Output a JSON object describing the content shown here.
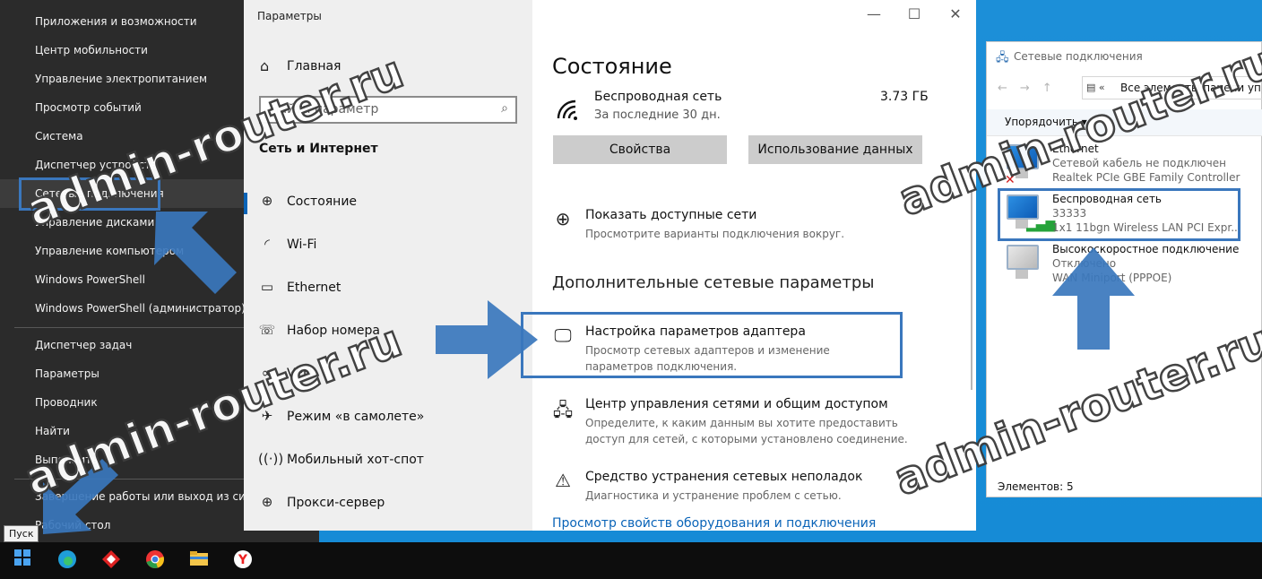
{
  "winx_menu": {
    "group1": [
      "Приложения и возможности",
      "Центр мобильности",
      "Управление электропитанием",
      "Просмотр событий",
      "Система",
      "Диспетчер устройств",
      "Сетевые подключения",
      "Управление дисками",
      "Управление компьютером",
      "Windows PowerShell",
      "Windows PowerShell (администратор)"
    ],
    "group2": [
      "Диспетчер задач",
      "Параметры",
      "Проводник",
      "Найти",
      "Выполнить"
    ],
    "group3": [
      "Завершение работы или выход из системы",
      "Рабочий стол"
    ],
    "highlighted": "Сетевые подключения"
  },
  "settings": {
    "window_title": "Параметры",
    "home": "Главная",
    "search_placeholder": "Найти параметр",
    "section": "Сеть и Интернет",
    "nav": [
      {
        "label": "Состояние",
        "icon": "globe-icon"
      },
      {
        "label": "Wi-Fi",
        "icon": "wifi-icon"
      },
      {
        "label": "Ethernet",
        "icon": "ethernet-icon"
      },
      {
        "label": "Набор номера",
        "icon": "dialup-icon"
      },
      {
        "label": "VPN",
        "icon": "vpn-icon"
      },
      {
        "label": "Режим «в самолете»",
        "icon": "airplane-icon"
      },
      {
        "label": "Мобильный хот-спот",
        "icon": "hotspot-icon"
      },
      {
        "label": "Прокси-сервер",
        "icon": "globe-icon"
      }
    ],
    "page_title": "Состояние",
    "network": {
      "name": "Беспроводная сеть",
      "period": "За последние 30 дн.",
      "usage": "3.73 ГБ"
    },
    "buttons": {
      "properties": "Свойства",
      "data_usage": "Использование данных"
    },
    "show_networks": {
      "title": "Показать доступные сети",
      "desc": "Просмотрите варианты подключения вокруг."
    },
    "advanced_heading": "Дополнительные сетевые параметры",
    "adapter": {
      "title": "Настройка параметров адаптера",
      "desc": "Просмотр сетевых адаптеров и изменение параметров подключения."
    },
    "sharing_center": {
      "title": "Центр управления сетями и общим доступом",
      "desc": "Определите, к каким данным вы хотите предоставить доступ для сетей, с которыми установлено соединение."
    },
    "troubleshoot": {
      "title": "Средство устранения сетевых неполадок",
      "desc": "Диагностика и устранение проблем с сетью."
    },
    "hardware_link": "Просмотр свойств оборудования и подключения"
  },
  "net_connections": {
    "window_title": "Сетевые подключения",
    "address": "Все элементы панели управления",
    "organize": "Упорядочить ▾",
    "items": [
      {
        "name": "Ethernet",
        "status": "Сетевой кабель не подключен",
        "device": "Realtek PCIe GBE Family Controller"
      },
      {
        "name": "Беспроводная сеть",
        "status": "33333",
        "device": "1x1 11bgn Wireless LAN PCI Expr..."
      },
      {
        "name": "Высокоскоростное подключение",
        "status": "Отключено",
        "device": "WAN Miniport (PPPOE)"
      }
    ],
    "status_bar": "Элементов: 5"
  },
  "taskbar": {
    "tooltip": "Пуск"
  },
  "watermark": "admin-router.ru",
  "colors": {
    "accent": "#0a64b8",
    "highlight_box": "#3a77bd",
    "menu_bg": "#2b2b2b",
    "desktop": "#1a8ad4"
  }
}
